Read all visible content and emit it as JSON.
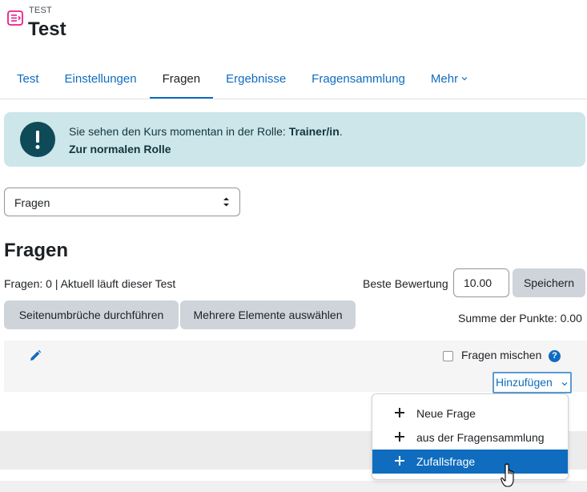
{
  "header": {
    "module_type": "TEST",
    "title": "Test",
    "icon": "quiz-icon",
    "icon_color": "#e91e8c"
  },
  "nav": {
    "tabs": [
      {
        "label": "Test",
        "active": false
      },
      {
        "label": "Einstellungen",
        "active": false
      },
      {
        "label": "Fragen",
        "active": true
      },
      {
        "label": "Ergebnisse",
        "active": false
      },
      {
        "label": "Fragensammlung",
        "active": false
      },
      {
        "label": "Mehr",
        "active": false
      }
    ]
  },
  "alert": {
    "text": "Sie sehen den Kurs momentan in der Rolle: ",
    "role": "Trainer/in",
    "suffix": ".",
    "link": "Zur normalen Rolle",
    "icon": "exclamation-icon"
  },
  "page_select": {
    "value": "Fragen"
  },
  "main": {
    "title": "Fragen",
    "info": "Fragen: 0 | Aktuell läuft dieser Test",
    "grade_label": "Beste Bewertung",
    "grade_value": "10.00",
    "save_label": "Speichern",
    "repaginate_label": "Seitenumbrüche durchführen",
    "select_multiple_label": "Mehrere Elemente auswählen",
    "sum_label": "Summe der Punkte: 0.00"
  },
  "section": {
    "shuffle_label": "Fragen mischen",
    "help": "?",
    "add_label": "Hinzufügen"
  },
  "add_menu": {
    "items": [
      {
        "label": "Neue Frage",
        "selected": false
      },
      {
        "label": "aus der Fragensammlung",
        "selected": false
      },
      {
        "label": "Zufallsfrage",
        "selected": true
      }
    ]
  },
  "colors": {
    "link": "#0f6cbf",
    "alert_bg": "#cce6ea",
    "alert_icon": "#0f4a58",
    "button_gray": "#ced4da"
  }
}
